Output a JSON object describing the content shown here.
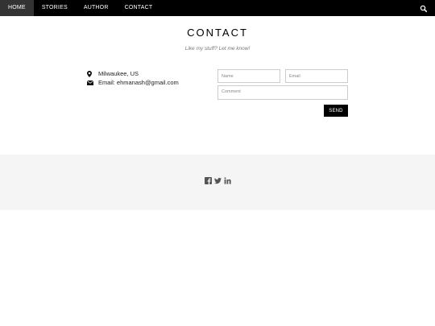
{
  "nav": {
    "items": [
      {
        "label": "HOME"
      },
      {
        "label": "STORIES"
      },
      {
        "label": "AUTHOR"
      },
      {
        "label": "CONTACT"
      }
    ],
    "search_icon": "search-icon"
  },
  "header": {
    "title": "CONTACT",
    "subtitle": "Like my stuff? Let me know!"
  },
  "contact": {
    "location": "Milwaukee, US",
    "location_icon": "map-marker-icon",
    "email": "Email: ehmanash@gmail.com",
    "email_icon": "envelope-icon"
  },
  "form": {
    "name_placeholder": "Name",
    "name_value": "",
    "email_placeholder": "Email",
    "email_value": "",
    "comment_placeholder": "Comment",
    "comment_value": "",
    "send_label": "SEND"
  },
  "footer": {
    "social": [
      "facebook-icon",
      "twitter-icon",
      "linkedin-icon"
    ]
  },
  "colors": {
    "topbar": "#000000",
    "footer_bg": "#f5f5f5",
    "button_bg": "#000000",
    "field_border": "#cccccc"
  }
}
